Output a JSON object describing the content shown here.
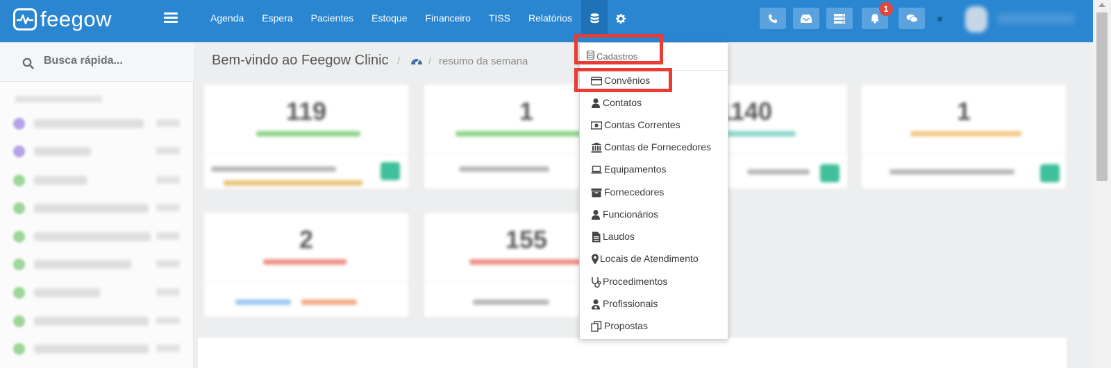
{
  "brand": {
    "name": "feegow"
  },
  "nav": {
    "items": [
      "Agenda",
      "Espera",
      "Pacientes",
      "Estoque",
      "Financeiro",
      "TISS",
      "Relatórios"
    ]
  },
  "notifications": {
    "count": "1"
  },
  "search": {
    "placeholder": "Busca rápida..."
  },
  "breadcrumb": {
    "title": "Bem-vindo ao Feegow Clinic",
    "current": "resumo da semana"
  },
  "dashboard": {
    "cards_row1": [
      "119",
      "1",
      "1140",
      "1"
    ],
    "cards_row2": [
      "2",
      "155"
    ]
  },
  "dropdown": {
    "header": "Cadastros",
    "items": [
      "Convênios",
      "Contatos",
      "Contas Correntes",
      "Contas de Fornecedores",
      "Equipamentos",
      "Fornecedores",
      "Funcionários",
      "Laudos",
      "Locais de Atendimento",
      "Procedimentos",
      "Profissionais",
      "Propostas"
    ]
  },
  "colors": {
    "topbar": "#2a86d1",
    "highlight": "#ea3b34",
    "badge": "#e0463c"
  }
}
